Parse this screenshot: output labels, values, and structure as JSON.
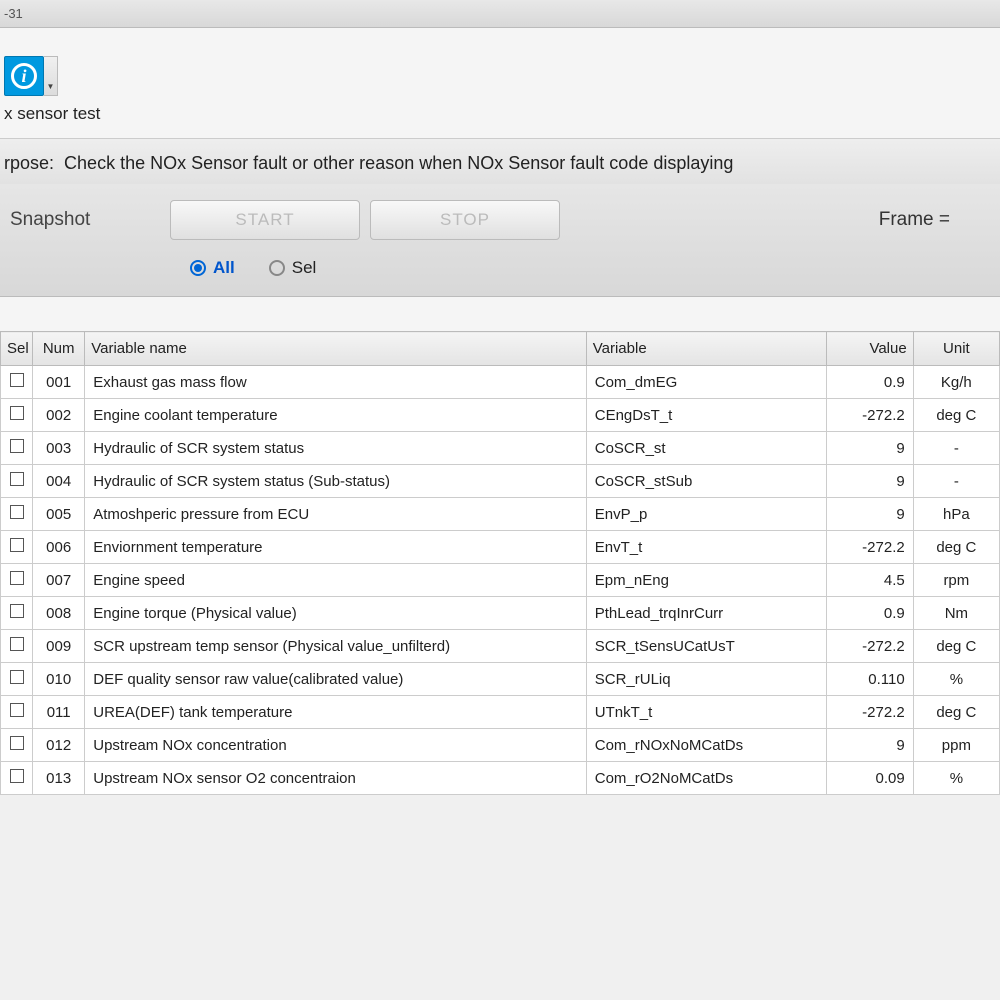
{
  "titlebar": "-31",
  "subtitle": "x sensor test",
  "purpose_label": "rpose:",
  "purpose_text": "Check the NOx Sensor fault or other reason when NOx Sensor fault code displaying",
  "controls": {
    "snapshot": "Snapshot",
    "start": "START",
    "stop": "STOP",
    "frame": "Frame ="
  },
  "radios": {
    "all": "All",
    "sel": "Sel"
  },
  "table": {
    "headers": {
      "sel": "Sel",
      "num": "Num",
      "name": "Variable name",
      "var": "Variable",
      "value": "Value",
      "unit": "Unit"
    },
    "rows": [
      {
        "num": "001",
        "name": "Exhaust gas mass flow",
        "var": "Com_dmEG",
        "value": "0.9",
        "unit": "Kg/h"
      },
      {
        "num": "002",
        "name": "Engine coolant temperature",
        "var": "CEngDsT_t",
        "value": "-272.2",
        "unit": "deg C"
      },
      {
        "num": "003",
        "name": "Hydraulic of SCR system status",
        "var": "CoSCR_st",
        "value": "9",
        "unit": "-"
      },
      {
        "num": "004",
        "name": "Hydraulic of SCR system status (Sub-status)",
        "var": "CoSCR_stSub",
        "value": "9",
        "unit": "-"
      },
      {
        "num": "005",
        "name": "Atmoshperic pressure from ECU",
        "var": "EnvP_p",
        "value": "9",
        "unit": "hPa"
      },
      {
        "num": "006",
        "name": "Enviornment temperature",
        "var": "EnvT_t",
        "value": "-272.2",
        "unit": "deg C"
      },
      {
        "num": "007",
        "name": "Engine speed",
        "var": "Epm_nEng",
        "value": "4.5",
        "unit": "rpm"
      },
      {
        "num": "008",
        "name": "Engine torque (Physical value)",
        "var": "PthLead_trqInrCurr",
        "value": "0.9",
        "unit": "Nm"
      },
      {
        "num": "009",
        "name": "SCR upstream temp sensor (Physical value_unfilterd)",
        "var": "SCR_tSensUCatUsT",
        "value": "-272.2",
        "unit": "deg C"
      },
      {
        "num": "010",
        "name": "DEF quality sensor raw value(calibrated value)",
        "var": "SCR_rULiq",
        "value": "0.110",
        "unit": "%"
      },
      {
        "num": "011",
        "name": "UREA(DEF) tank temperature",
        "var": "UTnkT_t",
        "value": "-272.2",
        "unit": "deg C"
      },
      {
        "num": "012",
        "name": "Upstream NOx concentration",
        "var": "Com_rNOxNoMCatDs",
        "value": "9",
        "unit": "ppm"
      },
      {
        "num": "013",
        "name": "Upstream NOx sensor O2 concentraion",
        "var": "Com_rO2NoMCatDs",
        "value": "0.09",
        "unit": "%"
      }
    ]
  }
}
